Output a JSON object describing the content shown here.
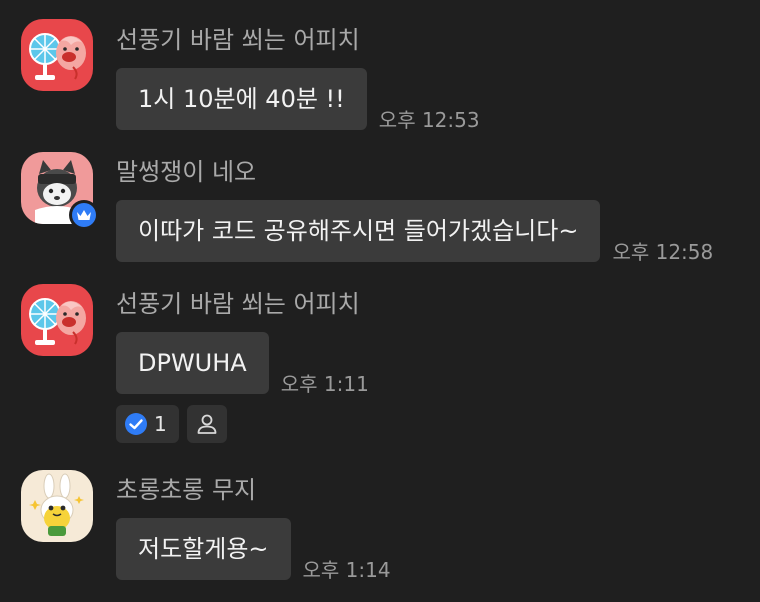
{
  "messages": [
    {
      "sender": "선풍기 바람 쐬는 어피치",
      "text": "1시 10분에 40분 !!",
      "time": "오후 12:53",
      "avatar_icon": "peach-fan-avatar-icon"
    },
    {
      "sender": "말썽쟁이 네오",
      "text": "이따가 코드 공유해주시면 들어가겠습니다~",
      "time": "오후 12:58",
      "avatar_icon": "neo-cat-avatar-icon",
      "badge_icon": "crown-icon"
    },
    {
      "sender": "선풍기 바람 쐬는 어피치",
      "text": "DPWUHA",
      "time": "오후 1:11",
      "avatar_icon": "peach-fan-avatar-icon",
      "reactions": {
        "check_count": "1",
        "check_icon": "check-circle-icon",
        "add_icon": "person-icon"
      }
    },
    {
      "sender": "초롱초롱 무지",
      "text": "저도할게용~",
      "time": "오후 1:14",
      "avatar_icon": "muzi-bunny-avatar-icon"
    }
  ],
  "colors": {
    "background": "#1f1f1f",
    "bubble": "#3b3b3b",
    "sender_text": "#a9a9a9",
    "time_text": "#9a9a9a",
    "accent_blue": "#2f7cf6"
  }
}
